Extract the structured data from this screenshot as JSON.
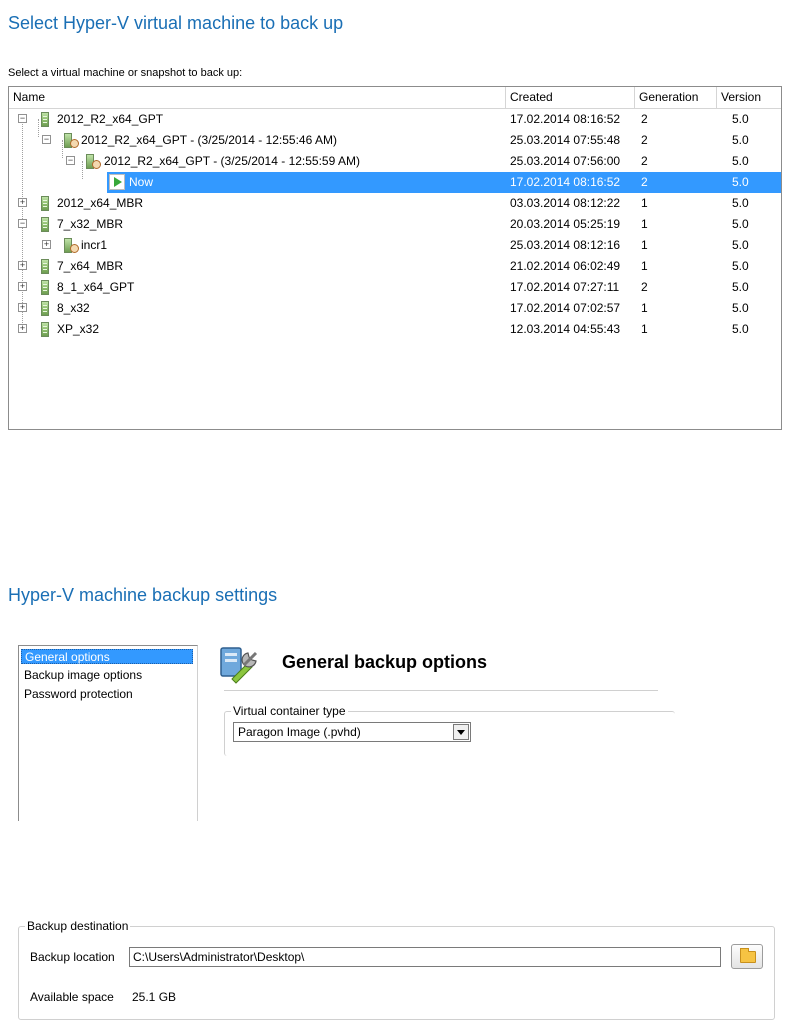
{
  "vm_section": {
    "title": "Select Hyper-V virtual machine to back up",
    "prompt": "Select a virtual machine or snapshot to back up:",
    "columns": [
      "Name",
      "Created",
      "Generation",
      "Version"
    ],
    "rows": [
      {
        "name": "2012_R2_x64_GPT",
        "created": "17.02.2014 08:16:52",
        "generation": "2",
        "version": "5.0"
      },
      {
        "name": "2012_R2_x64_GPT - (3/25/2014 - 12:55:46 AM)",
        "created": "25.03.2014 07:55:48",
        "generation": "2",
        "version": "5.0"
      },
      {
        "name": "2012_R2_x64_GPT - (3/25/2014 - 12:55:59 AM)",
        "created": "25.03.2014 07:56:00",
        "generation": "2",
        "version": "5.0"
      },
      {
        "name": "Now",
        "created": "17.02.2014 08:16:52",
        "generation": "2",
        "version": "5.0"
      },
      {
        "name": "2012_x64_MBR",
        "created": "03.03.2014 08:12:22",
        "generation": "1",
        "version": "5.0"
      },
      {
        "name": "7_x32_MBR",
        "created": "20.03.2014 05:25:19",
        "generation": "1",
        "version": "5.0"
      },
      {
        "name": "incr1",
        "created": "25.03.2014 08:12:16",
        "generation": "1",
        "version": "5.0"
      },
      {
        "name": "7_x64_MBR",
        "created": "21.02.2014 06:02:49",
        "generation": "1",
        "version": "5.0"
      },
      {
        "name": "8_1_x64_GPT",
        "created": "17.02.2014 07:27:11",
        "generation": "2",
        "version": "5.0"
      },
      {
        "name": "8_x32",
        "created": "17.02.2014 07:02:57",
        "generation": "1",
        "version": "5.0"
      },
      {
        "name": "XP_x32",
        "created": "12.03.2014 04:55:43",
        "generation": "1",
        "version": "5.0"
      }
    ],
    "selected_row": "Now"
  },
  "settings_section": {
    "title": "Hyper-V machine backup settings",
    "nav_items": [
      "General options",
      "Backup image options",
      "Password protection"
    ],
    "selected_nav": "General options",
    "options_icon": "wrench-settings-icon",
    "options_title": "General backup options",
    "container_group_label": "Virtual container type",
    "container_type_value": "Paragon Image (.pvhd)"
  },
  "destination_section": {
    "group_label": "Backup destination",
    "location_label": "Backup location",
    "location_value": "C:\\Users\\Administrator\\Desktop\\",
    "browse_icon": "folder-icon",
    "space_label": "Available space",
    "space_value": "25.1 GB"
  },
  "colors": {
    "title_blue": "#1a6fb5",
    "selection_blue": "#3399ff"
  }
}
